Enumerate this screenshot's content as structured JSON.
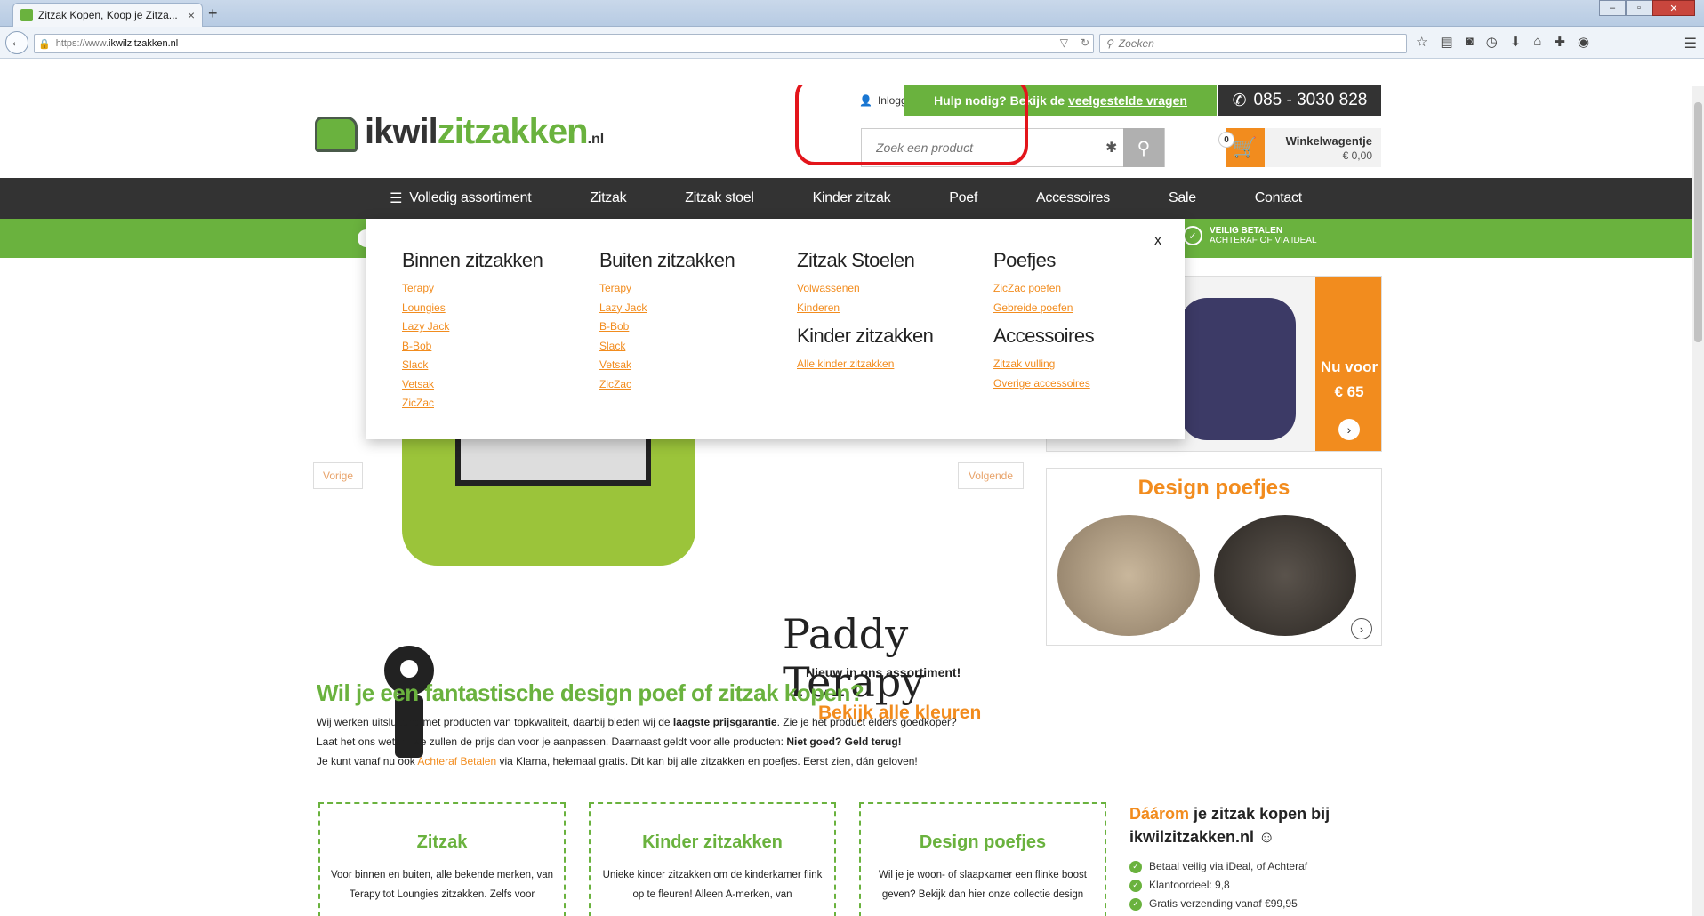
{
  "browser": {
    "tab_title": "Zitzak Kopen, Koop je Zitza...",
    "tab_close": "×",
    "new_tab": "+",
    "url_proto": "https://www.",
    "url_host": "ikwilzitzakken.nl",
    "search_placeholder": "Zoeken"
  },
  "header": {
    "logo_part1": "ikwil",
    "logo_part2": "zitzakken",
    "logo_tld": ".nl",
    "login_label": "Inloggen",
    "help_text": "Hulp nodig? Bekijk de",
    "help_link": "veelgestelde vragen",
    "phone": "085 - 3030 828",
    "search_placeholder": "Zoek een product",
    "cart_count": "0",
    "cart_label": "Winkelwagentje",
    "cart_total": "€ 0,00"
  },
  "nav": {
    "items": [
      "Volledig assortiment",
      "Zitzak",
      "Zitzak stoel",
      "Kinder zitzak",
      "Poef",
      "Accessoires",
      "Sale",
      "Contact"
    ]
  },
  "usp": {
    "pay_title": "VEILIG BETALEN",
    "pay_sub": "ACHTERAF OF VIA IDEAL"
  },
  "mega_menu": {
    "close_label": "x",
    "columns": [
      {
        "heading": "Binnen zitzakken",
        "links": [
          "Terapy",
          "Loungies",
          "Lazy Jack",
          "B-Bob",
          "Slack",
          "Vetsak",
          "ZicZac"
        ]
      },
      {
        "heading": "Buiten zitzakken",
        "links": [
          "Terapy",
          "Lazy Jack",
          "B-Bob",
          "Slack",
          "Vetsak",
          "ZicZac"
        ]
      },
      {
        "heading": "Zitzak Stoelen",
        "links": [
          "Volwassenen",
          "Kinderen"
        ],
        "heading2": "Kinder zitzakken",
        "links2": [
          "Alle kinder zitzakken"
        ]
      },
      {
        "heading": "Poefjes",
        "links": [
          "ZicZac poefen",
          "Gebreide poefen"
        ],
        "heading2": "Accessoires",
        "links2": [
          "Zitzak vulling",
          "Overige accessoires"
        ]
      }
    ]
  },
  "hero": {
    "title": "Paddy Terapy",
    "subtitle": "Nieuw in ons assortiment!",
    "cta": "Bekijk alle kleuren",
    "prev": "Vorige",
    "next": "Volgende"
  },
  "promos": {
    "price_line1": "Nu voor",
    "price_line2": "€ 65",
    "poufs_title": "Design poefjes"
  },
  "intro": {
    "heading": "Wil je een fantastische design poef of zitzak kopen?",
    "l1a": "Wij werken uitsluitend met producten van topkwaliteit, daarbij bieden wij de ",
    "l1b": "laagste prijsgarantie",
    "l1c": ". Zie je het product elders goedkoper?",
    "l2a": "Laat het ons weten, we zullen de prijs dan voor je aanpassen. Daarnaast geldt voor alle producten: ",
    "l2b": "Niet goed? Geld terug!",
    "l3a": "Je kunt vanaf nu ook ",
    "l3b": "Achteraf Betalen",
    "l3c": " via Klarna, helemaal gratis. Dit kan bij alle zitzakken en poefjes. Eerst zien, dán geloven!"
  },
  "cards": [
    {
      "title": "Zitzak",
      "text": "Voor binnen en buiten, alle bekende merken, van Terapy tot Loungies zitzakken. Zelfs voor"
    },
    {
      "title": "Kinder zitzakken",
      "text": "Unieke kinder zitzakken om de kinderkamer flink op te fleuren! Alleen A-merken, van"
    },
    {
      "title": "Design poefjes",
      "text": "Wil je je woon- of slaapkamer een flinke boost geven? Bekijk dan hier onze collectie design"
    }
  ],
  "why": {
    "title_or": "Dáárom",
    "title_rest": " je zitzak kopen bij ikwilzitzakken.nl ☺",
    "items": [
      "Betaal veilig via iDeal, of Achteraf",
      "Klantoordeel: 9,8",
      "Gratis verzending vanaf €99,95"
    ]
  },
  "colors": {
    "green": "#6ab23e",
    "orange": "#f28c1e",
    "dark": "#333333",
    "highlight": "#e3151b"
  }
}
